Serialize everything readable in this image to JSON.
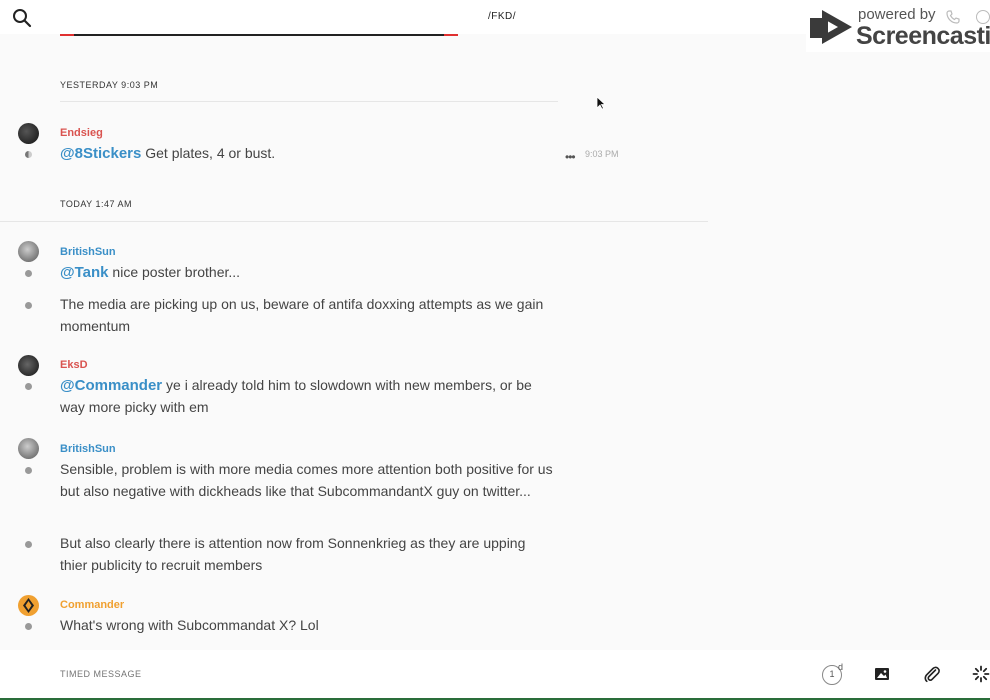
{
  "header": {
    "channel_name": "/FKD/",
    "progress": 1.0
  },
  "watermark": {
    "powered_by": "powered by",
    "brand": "Screencastify"
  },
  "dates": {
    "yesterday": "YESTERDAY 9:03 PM",
    "today": "TODAY 1:47 AM"
  },
  "messages": [
    {
      "user": "Endsieg",
      "user_color": "#d9534f",
      "mention": "@8Stickers",
      "text": " Get plates, 4 or bust.",
      "time": "9:03 PM"
    },
    {
      "user": "BritishSun",
      "user_color": "#3a8fc7",
      "mention": "@Tank",
      "text": " nice poster brother..."
    },
    {
      "text": "The media are picking up on us, beware of antifa doxxing attempts as we gain momentum"
    },
    {
      "user": "EksD",
      "user_color": "#d9534f",
      "mention": "@Commander",
      "text": " ye i already told him to slowdown with new members, or be way more picky with em"
    },
    {
      "user": "BritishSun",
      "user_color": "#3a8fc7",
      "text": "Sensible, problem is with more media comes more attention both positive for us but also negative with dickheads like that SubcommandantX guy on twitter..."
    },
    {
      "text": "But also clearly there is attention now from Sonnenkrieg as they are upping thier publicity to recruit members"
    },
    {
      "user": "Commander",
      "user_color": "#f0a030",
      "text": "What's wrong with Subcommandat X? Lol"
    }
  ],
  "composer": {
    "placeholder": "TIMED MESSAGE",
    "timer_value": "1",
    "timer_unit": "d"
  },
  "icons": {
    "search": "search-icon",
    "more": "more-options-icon",
    "image": "image-icon",
    "attach": "paperclip-icon",
    "loading": "spinner-icon",
    "phone": "phone-icon",
    "info": "info-icon"
  }
}
